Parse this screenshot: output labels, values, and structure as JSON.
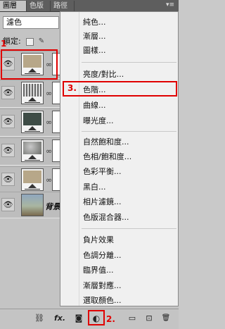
{
  "tabs": [
    {
      "label": "圖層"
    },
    {
      "label": "色版"
    },
    {
      "label": "路徑"
    }
  ],
  "tab_menu_icon": "panel-menu-icon",
  "blend_mode": "濾色",
  "lock_label": "鎖定:",
  "layers": [
    {
      "name": "",
      "thumb_color": "#b7a789",
      "selected": true
    },
    {
      "name": "",
      "thumb_color": "#c8c8c8"
    },
    {
      "name": "",
      "thumb_color": "#3e4c46"
    },
    {
      "name": "",
      "thumb_color": "#8f918d"
    },
    {
      "name": "",
      "thumb_color": "#b7a789"
    },
    {
      "name": "背景",
      "thumb_color": "#8fa6bf"
    }
  ],
  "menu": {
    "groups": [
      [
        "純色...",
        "漸層...",
        "圖樣..."
      ],
      [
        "亮度/對比...",
        "色階...",
        "曲線...",
        "曝光度..."
      ],
      [
        "自然飽和度...",
        "色相/飽和度...",
        "色彩平衡...",
        "黑白...",
        "相片濾鏡...",
        "色版混合器..."
      ],
      [
        "負片效果",
        "色調分離...",
        "臨界值...",
        "漸層對應...",
        "選取顏色..."
      ]
    ]
  },
  "annotations": {
    "step1": "1",
    "step2": "2.",
    "step3": "3."
  },
  "bottom_buttons": [
    {
      "label": "link-icon",
      "glyph": "⛓"
    },
    {
      "label": "fx-icon",
      "glyph": "fx."
    },
    {
      "label": "add-mask-icon",
      "glyph": "◙"
    },
    {
      "label": "new-adjustment-icon",
      "glyph": "◐"
    },
    {
      "label": "new-group-icon",
      "glyph": "▭"
    },
    {
      "label": "new-layer-icon",
      "glyph": "⊡"
    },
    {
      "label": "delete-icon",
      "glyph": "🗑"
    }
  ],
  "colors": {
    "annotation_red": "#e00000"
  }
}
